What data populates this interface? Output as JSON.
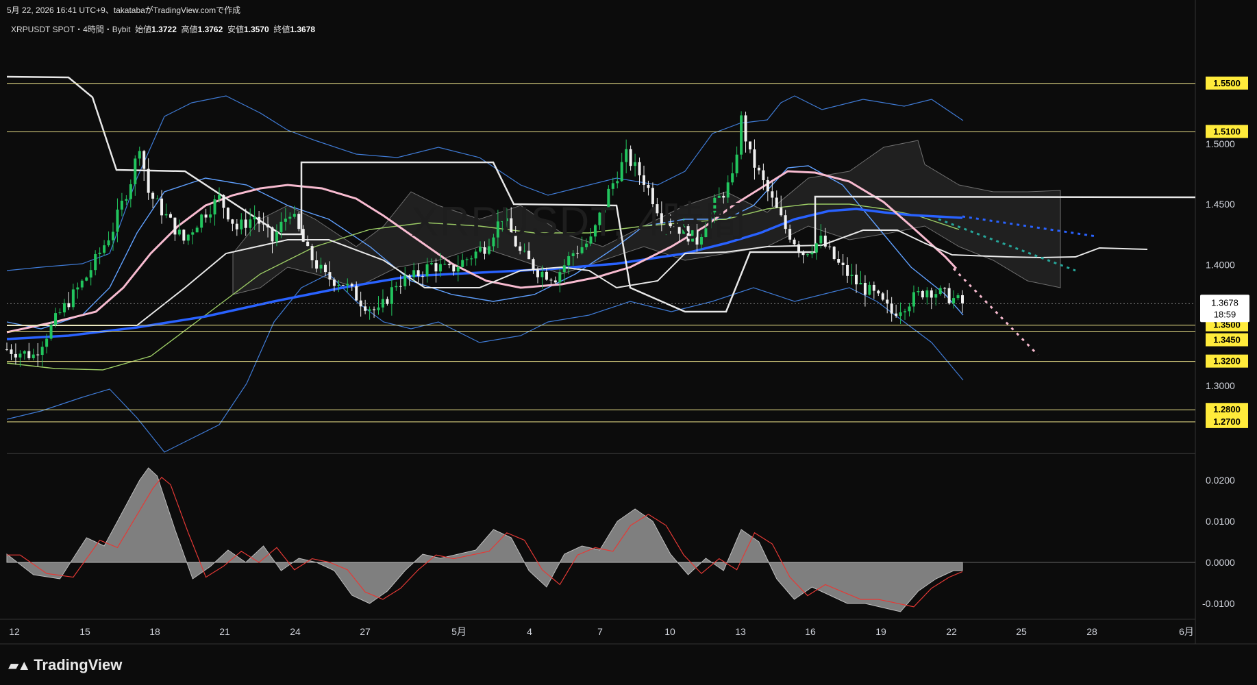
{
  "header": {
    "caption": "5月 22, 2026 16:41 UTC+9、takatabaがTradingView.comで作成",
    "symbol": "XRPUSDT SPOT・4時間・Bybit",
    "open_label": "始値",
    "open": "1.3722",
    "high_label": "高値",
    "high": "1.3762",
    "low_label": "安値",
    "low": "1.3570",
    "close_label": "終値",
    "close": "1.3678"
  },
  "watermark": "XRPUSDT, 4時間",
  "brand": "TradingView",
  "colors": {
    "bull": "#22c55e",
    "bear": "#f0f0f0",
    "ma_blue": "#2962ff",
    "ma_pink": "#f8bbd0",
    "ma_green": "#9ccc65",
    "band": "#3f7bd6",
    "support": "#f0e68c",
    "kijun": "#ffffff",
    "hist": "#8c8c8c",
    "signal": "#e53935",
    "price_tag": "#ffffff",
    "level_tag": "#ffeb3b"
  },
  "chart_data": [
    {
      "type": "candlestick",
      "pair": "XRPUSDT",
      "timeframe": "4h",
      "ylim": [
        1.245,
        1.585
      ],
      "y_ticks": [
        "1.5000",
        "1.4500",
        "1.4000",
        "1.3000"
      ],
      "x_labels": [
        "12",
        "15",
        "18",
        "21",
        "24",
        "27",
        "5月",
        "4",
        "7",
        "10",
        "13",
        "16",
        "19",
        "22",
        "25",
        "28",
        "6月"
      ],
      "horizontal_levels": [
        {
          "value": 1.55,
          "label": "1.5500"
        },
        {
          "value": 1.51,
          "label": "1.5100"
        },
        {
          "value": 1.35,
          "label": "1.3500"
        },
        {
          "value": 1.345,
          "label": "1.3450"
        },
        {
          "value": 1.32,
          "label": "1.3200"
        },
        {
          "value": 1.28,
          "label": "1.2800"
        },
        {
          "value": 1.27,
          "label": "1.2700"
        }
      ],
      "current_price": {
        "value": 1.3678,
        "label": "1.3678",
        "countdown": "18:59"
      },
      "price_path": [
        [
          0,
          1.33
        ],
        [
          3,
          1.325
        ],
        [
          6,
          1.36
        ],
        [
          9,
          1.39
        ],
        [
          12,
          1.43
        ],
        [
          14,
          1.47
        ],
        [
          15,
          1.5
        ],
        [
          16,
          1.46
        ],
        [
          18,
          1.44
        ],
        [
          20,
          1.42
        ],
        [
          22,
          1.44
        ],
        [
          24,
          1.455
        ],
        [
          26,
          1.43
        ],
        [
          28,
          1.44
        ],
        [
          30,
          1.42
        ],
        [
          32,
          1.445
        ],
        [
          34,
          1.41
        ],
        [
          36,
          1.39
        ],
        [
          38,
          1.385
        ],
        [
          40,
          1.37
        ],
        [
          42,
          1.36
        ],
        [
          44,
          1.385
        ],
        [
          46,
          1.39
        ],
        [
          48,
          1.4
        ],
        [
          50,
          1.395
        ],
        [
          52,
          1.405
        ],
        [
          54,
          1.415
        ],
        [
          56,
          1.44
        ],
        [
          58,
          1.41
        ],
        [
          60,
          1.395
        ],
        [
          62,
          1.39
        ],
        [
          64,
          1.41
        ],
        [
          66,
          1.42
        ],
        [
          68,
          1.46
        ],
        [
          70,
          1.49
        ],
        [
          72,
          1.47
        ],
        [
          74,
          1.44
        ],
        [
          76,
          1.43
        ],
        [
          78,
          1.42
        ],
        [
          80,
          1.45
        ],
        [
          82,
          1.47
        ],
        [
          83,
          1.52
        ],
        [
          84,
          1.49
        ],
        [
          86,
          1.46
        ],
        [
          88,
          1.43
        ],
        [
          90,
          1.41
        ],
        [
          92,
          1.42
        ],
        [
          94,
          1.4
        ],
        [
          96,
          1.385
        ],
        [
          98,
          1.375
        ],
        [
          100,
          1.36
        ],
        [
          102,
          1.37
        ],
        [
          104,
          1.38
        ],
        [
          106,
          1.375
        ],
        [
          108,
          1.368
        ]
      ]
    },
    {
      "type": "area",
      "indicator": "oscillator",
      "ylim": [
        -0.0135,
        0.0265
      ],
      "y_ticks": [
        "0.0200",
        "0.0100",
        "0.0000",
        "-0.0100"
      ],
      "values": [
        [
          0,
          0.002
        ],
        [
          3,
          -0.003
        ],
        [
          6,
          -0.004
        ],
        [
          9,
          0.006
        ],
        [
          11,
          0.004
        ],
        [
          13,
          0.012
        ],
        [
          15,
          0.02
        ],
        [
          16,
          0.023
        ],
        [
          17,
          0.021
        ],
        [
          19,
          0.008
        ],
        [
          21,
          -0.004
        ],
        [
          23,
          -0.001
        ],
        [
          25,
          0.003
        ],
        [
          27,
          0.0
        ],
        [
          29,
          0.004
        ],
        [
          31,
          -0.002
        ],
        [
          33,
          0.001
        ],
        [
          35,
          0.0
        ],
        [
          37,
          -0.002
        ],
        [
          39,
          -0.008
        ],
        [
          41,
          -0.01
        ],
        [
          43,
          -0.007
        ],
        [
          45,
          -0.002
        ],
        [
          47,
          0.002
        ],
        [
          49,
          0.001
        ],
        [
          51,
          0.002
        ],
        [
          53,
          0.003
        ],
        [
          55,
          0.008
        ],
        [
          57,
          0.006
        ],
        [
          59,
          -0.002
        ],
        [
          61,
          -0.006
        ],
        [
          63,
          0.002
        ],
        [
          65,
          0.004
        ],
        [
          67,
          0.003
        ],
        [
          69,
          0.01
        ],
        [
          71,
          0.013
        ],
        [
          73,
          0.01
        ],
        [
          75,
          0.002
        ],
        [
          77,
          -0.003
        ],
        [
          79,
          0.001
        ],
        [
          81,
          -0.002
        ],
        [
          83,
          0.008
        ],
        [
          85,
          0.005
        ],
        [
          87,
          -0.004
        ],
        [
          89,
          -0.009
        ],
        [
          91,
          -0.006
        ],
        [
          93,
          -0.008
        ],
        [
          95,
          -0.01
        ],
        [
          97,
          -0.01
        ],
        [
          99,
          -0.011
        ],
        [
          101,
          -0.012
        ],
        [
          103,
          -0.007
        ],
        [
          105,
          -0.004
        ],
        [
          107,
          -0.002
        ],
        [
          108,
          -0.002
        ]
      ]
    }
  ]
}
